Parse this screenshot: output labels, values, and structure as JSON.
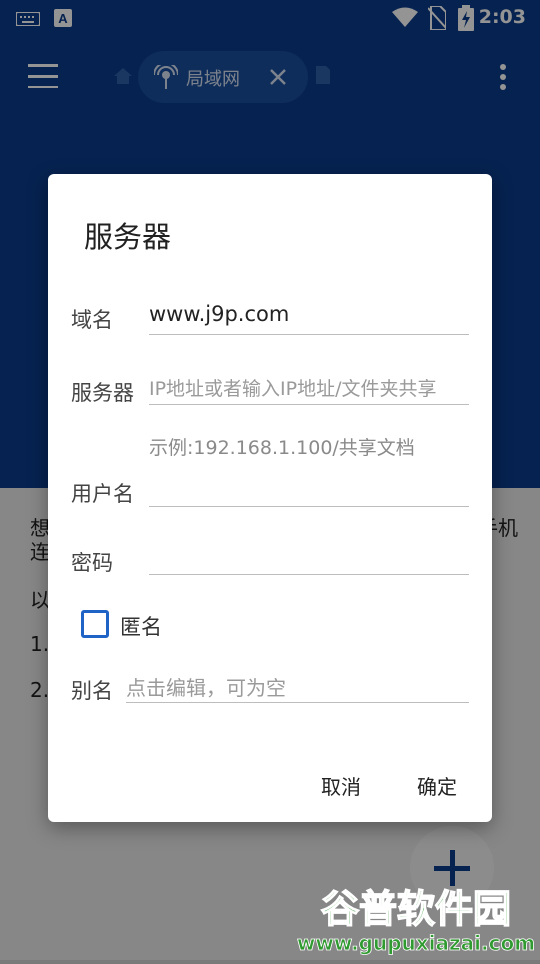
{
  "status_bar": {
    "time": "2:03"
  },
  "app_bar": {
    "tab_label": "局域网"
  },
  "background_text": {
    "line1_start": "想",
    "line1_end": "手机",
    "line2_start": "连",
    "line3": "以",
    "item1": "1.",
    "item2": "2."
  },
  "dialog": {
    "title": "服务器",
    "domain_label": "域名",
    "domain_value": "www.j9p.com",
    "server_label": "服务器",
    "server_placeholder": "IP地址或者输入IP地址/文件夹共享",
    "server_example": "示例:192.168.1.100/共享文档",
    "username_label": "用户名",
    "username_value": "",
    "password_label": "密码",
    "password_value": "",
    "anonymous_label": "匿名",
    "anonymous_checked": false,
    "alias_label": "别名",
    "alias_placeholder": "点击编辑，可为空",
    "cancel_label": "取消",
    "ok_label": "确定"
  },
  "watermark": {
    "title": "谷普软件园",
    "url": "www.gupuxiazai.com"
  },
  "colors": {
    "brand_blue": "#0b3c8a",
    "accent": "#1f63c7"
  }
}
